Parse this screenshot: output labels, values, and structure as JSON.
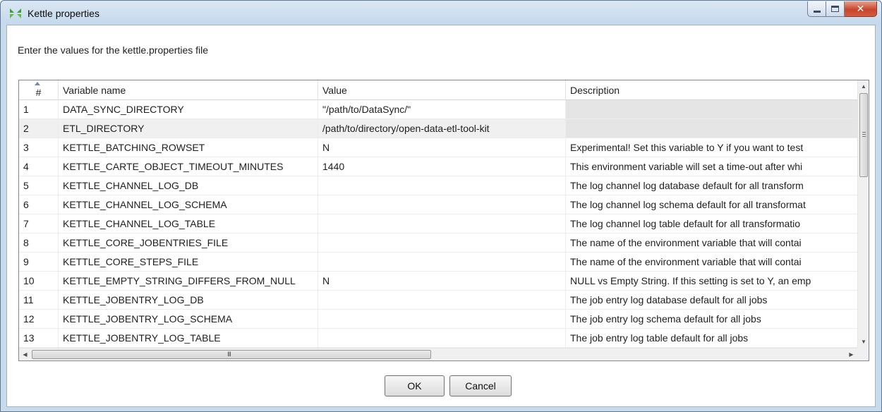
{
  "window": {
    "title": "Kettle properties"
  },
  "instruction": "Enter the values for the kettle.properties file",
  "table": {
    "columns": [
      "#",
      "Variable name",
      "Value",
      "Description"
    ],
    "rows": [
      {
        "num": "1",
        "name": "DATA_SYNC_DIRECTORY",
        "value": "\"/path/to/DataSync/\"",
        "desc": ""
      },
      {
        "num": "2",
        "name": "ETL_DIRECTORY",
        "value": "/path/to/directory/open-data-etl-tool-kit",
        "desc": ""
      },
      {
        "num": "3",
        "name": "KETTLE_BATCHING_ROWSET",
        "value": "N",
        "desc": "Experimental! Set this variable to Y if you want to test"
      },
      {
        "num": "4",
        "name": "KETTLE_CARTE_OBJECT_TIMEOUT_MINUTES",
        "value": "1440",
        "desc": "This environment variable will set a time-out after whi"
      },
      {
        "num": "5",
        "name": "KETTLE_CHANNEL_LOG_DB",
        "value": "",
        "desc": "The log channel log database default for all transform"
      },
      {
        "num": "6",
        "name": "KETTLE_CHANNEL_LOG_SCHEMA",
        "value": "",
        "desc": "The log channel log schema default for all transformat"
      },
      {
        "num": "7",
        "name": "KETTLE_CHANNEL_LOG_TABLE",
        "value": "",
        "desc": "The log channel log table default for all transformatio"
      },
      {
        "num": "8",
        "name": "KETTLE_CORE_JOBENTRIES_FILE",
        "value": "",
        "desc": "The name of the environment variable that will contai"
      },
      {
        "num": "9",
        "name": "KETTLE_CORE_STEPS_FILE",
        "value": "",
        "desc": "The name of the environment variable that will contai"
      },
      {
        "num": "10",
        "name": "KETTLE_EMPTY_STRING_DIFFERS_FROM_NULL",
        "value": "N",
        "desc": "NULL vs Empty String. If this setting is set to Y, an emp"
      },
      {
        "num": "11",
        "name": "KETTLE_JOBENTRY_LOG_DB",
        "value": "",
        "desc": "The job entry log database default for all jobs"
      },
      {
        "num": "12",
        "name": "KETTLE_JOBENTRY_LOG_SCHEMA",
        "value": "",
        "desc": "The job entry log schema default for all jobs"
      },
      {
        "num": "13",
        "name": "KETTLE_JOBENTRY_LOG_TABLE",
        "value": "",
        "desc": "The job entry log table default for all jobs"
      }
    ]
  },
  "buttons": {
    "ok": "OK",
    "cancel": "Cancel"
  },
  "colors": {
    "title_bar": "#c5d8ec",
    "selected_row": "#f0f0f0",
    "readonly_cell": "#e5e5e5"
  }
}
